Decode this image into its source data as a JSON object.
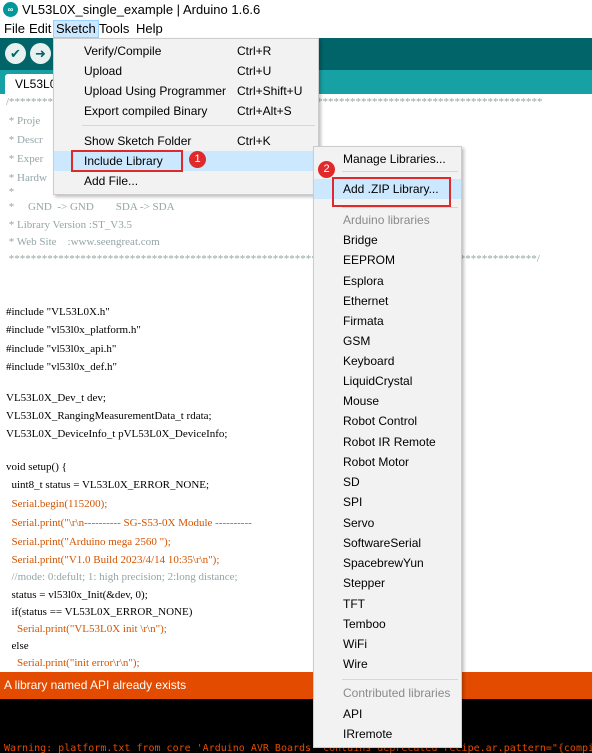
{
  "window": {
    "title": "VL53L0X_single_example | Arduino 1.6.6"
  },
  "menubar": [
    "File",
    "Edit",
    "Sketch",
    "Tools",
    "Help"
  ],
  "toolbar": {
    "verify_icon": "checkmark-icon",
    "upload_icon": "arrow-right-icon"
  },
  "tab": {
    "label": "VL53L0"
  },
  "editor": {
    "lines": [
      "/*************************************************************************************************",
      " * Proje",
      " * Descr",
      " * Exper",
      " * Hardw",
      " *",
      " *     GND  -> GND        SDA -> SDA",
      " * Library Version :ST_V3.5",
      " * Web Site    :www.seengreat.com",
      " ************************************************************************************************/",
      "",
      "",
      "#include \"VL53L0X.h\"",
      "#include \"vl53l0x_platform.h\"",
      "#include \"vl53l0x_api.h\"",
      "#include \"vl53l0x_def.h\"",
      "",
      "VL53L0X_Dev_t dev;",
      "VL53L0X_RangingMeasurementData_t rdata;",
      "VL53L0X_DeviceInfo_t pVL53L0X_DeviceInfo;",
      "",
      "void setup() {",
      "  uint8_t status = VL53L0X_ERROR_NONE;",
      "  Serial.begin(115200);",
      "  Serial.print(\"\\r\\n---------- SG-S53-0X Module ----------",
      "  Serial.print(\"Arduino mega 2560 \");",
      "  Serial.print(\"V1.0 Build 2023/4/14 10:35\\r\\n\");",
      "  //mode: 0:defult; 1: high precision; 2:long distance;",
      "  status = vl53l0x_Init(&dev, 0);",
      "  if(status == VL53L0X_ERROR_NONE)",
      "    Serial.print(\"VL53L0X init \\r\\n\");",
      "  else",
      "    Serial.print(\"init error\\r\\n\");"
    ]
  },
  "sketch_menu": {
    "items": [
      {
        "label": "Verify/Compile",
        "shortcut": "Ctrl+R"
      },
      {
        "label": "Upload",
        "shortcut": "Ctrl+U"
      },
      {
        "label": "Upload Using Programmer",
        "shortcut": "Ctrl+Shift+U"
      },
      {
        "label": "Export compiled Binary",
        "shortcut": "Ctrl+Alt+S"
      },
      {
        "label": "Show Sketch Folder",
        "shortcut": "Ctrl+K"
      },
      {
        "label": "Include Library",
        "shortcut": ""
      },
      {
        "label": "Add File...",
        "shortcut": ""
      }
    ],
    "badge": "1"
  },
  "library_menu": {
    "manage": "Manage Libraries...",
    "add_zip": "Add .ZIP Library...",
    "badge": "2",
    "arduino_header": "Arduino libraries",
    "arduino_libs": [
      "Bridge",
      "EEPROM",
      "Esplora",
      "Ethernet",
      "Firmata",
      "GSM",
      "Keyboard",
      "LiquidCrystal",
      "Mouse",
      "Robot Control",
      "Robot IR Remote",
      "Robot Motor",
      "SD",
      "SPI",
      "Servo",
      "SoftwareSerial",
      "SpacebrewYun",
      "Stepper",
      "TFT",
      "Temboo",
      "WiFi",
      "Wire"
    ],
    "contributed_header": "Contributed libraries",
    "contributed_libs": [
      "API",
      "IRremote"
    ]
  },
  "status": {
    "message": "A library named API already exists"
  },
  "console": {
    "line": "Warning: platform.txt from core 'Arduino AVR Boards' contains deprecated recipe.ar.pattern=\"{compiler.path}"
  },
  "colors": {
    "teal": "#006468",
    "tab_strip": "#17a1a5",
    "status_orange": "#e34c00",
    "highlight": "#cce8ff",
    "annotation_red": "#e0292b"
  }
}
